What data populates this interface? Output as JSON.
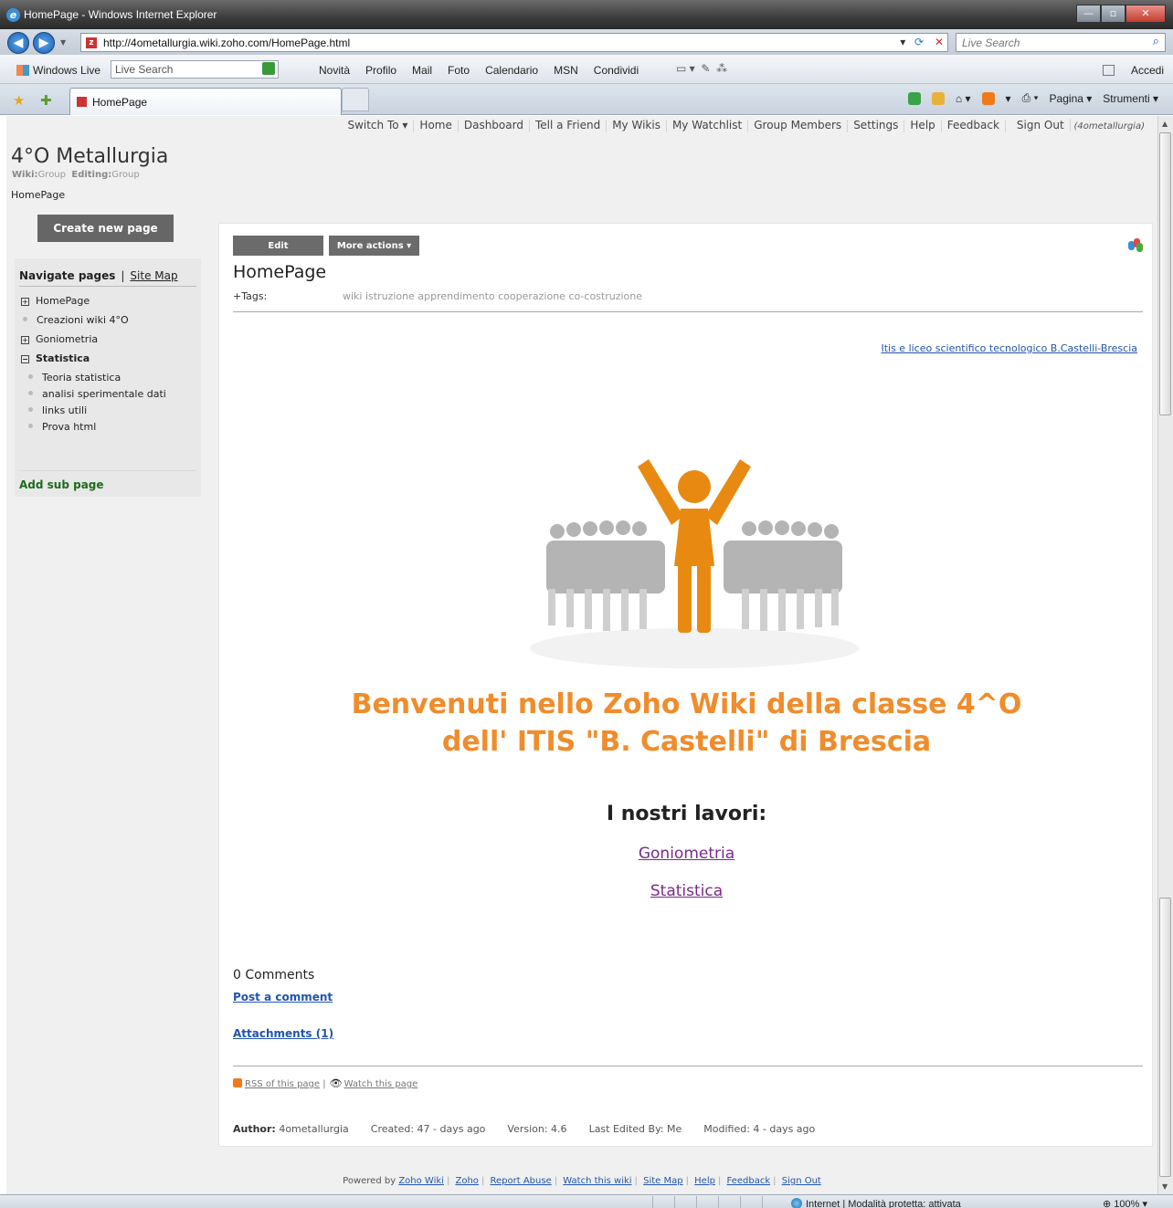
{
  "window": {
    "title": "HomePage - Windows Internet Explorer",
    "url": "http://4ometallurgia.wiki.zoho.com/HomePage.html",
    "search_placeholder": "Live Search"
  },
  "live_bar": {
    "brand": "Windows Live",
    "search_value": "Live Search",
    "links": [
      "Novità",
      "Profilo",
      "Mail",
      "Foto",
      "Calendario",
      "MSN",
      "Condividi"
    ],
    "signin": "Accedi"
  },
  "tab": {
    "title": "HomePage",
    "commands": {
      "page": "Pagina ▾",
      "tools": "Strumenti ▾"
    }
  },
  "topnav": {
    "items": [
      "Switch To ▾",
      "Home",
      "Dashboard",
      "Tell a Friend",
      "My Wikis",
      "My Watchlist",
      "Group Members",
      "Settings",
      "Help",
      "Feedback",
      "Sign Out"
    ],
    "user": "(4ometallurgia)"
  },
  "wiki": {
    "title": "4°O Metallurgia",
    "meta_wiki_label": "Wiki:",
    "meta_wiki_value": "Group",
    "meta_edit_label": "Editing:",
    "meta_edit_value": "Group",
    "breadcrumb": "HomePage"
  },
  "sidebar": {
    "create_button": "Create new page",
    "nav_heading": "Navigate pages",
    "sitemap": "Site Map",
    "items": [
      {
        "label": "HomePage",
        "marker": "⊞"
      },
      {
        "label": "Creazioni wiki 4°O",
        "marker": "dot"
      },
      {
        "label": "Goniometria",
        "marker": "⊞"
      },
      {
        "label": "Statistica",
        "marker": "⊟"
      }
    ],
    "sub_items": [
      "Teoria statistica",
      "analisi sperimentale dati",
      "links utili",
      "Prova html"
    ],
    "add_sub": "Add sub page"
  },
  "page": {
    "edit_button": "Edit",
    "more_actions": "More actions ▾",
    "heading": "HomePage",
    "tags_label": "+Tags:",
    "tags": "wiki istruzione apprendimento cooperazione co-costruzione",
    "school_link": "Itis e liceo scientifico tecnologico B.Castelli-Brescia",
    "welcome_line1": "Benvenuti nello Zoho Wiki della classe 4^O",
    "welcome_line2": "dell' ITIS \"B. Castelli\" di Brescia",
    "works_heading": "I nostri lavori:",
    "work_links": [
      "Goniometria",
      "Statistica"
    ],
    "comments_heading": "0 Comments",
    "post_comment": "Post a comment",
    "attachments": "Attachments (1)",
    "rss": "RSS of this page",
    "watch": "Watch this page",
    "meta": {
      "author_label": "Author:",
      "author": "4ometallurgia",
      "created": "Created: 47 - days ago",
      "version": "Version: 4.6",
      "last_edited": "Last Edited By: Me",
      "modified": "Modified: 4 - days ago"
    }
  },
  "footer": {
    "powered_by": "Powered by",
    "links": [
      "Zoho Wiki",
      "Zoho",
      "Report Abuse",
      "Watch this wiki",
      "Site Map",
      "Help",
      "Feedback",
      "Sign Out"
    ]
  },
  "status": {
    "zone": "Internet | Modalità protetta: attivata",
    "zoom": "100%"
  },
  "colors": {
    "accent_orange": "#f08c2c",
    "link_blue": "#2255aa",
    "visited_purple": "#7a2a8a"
  }
}
